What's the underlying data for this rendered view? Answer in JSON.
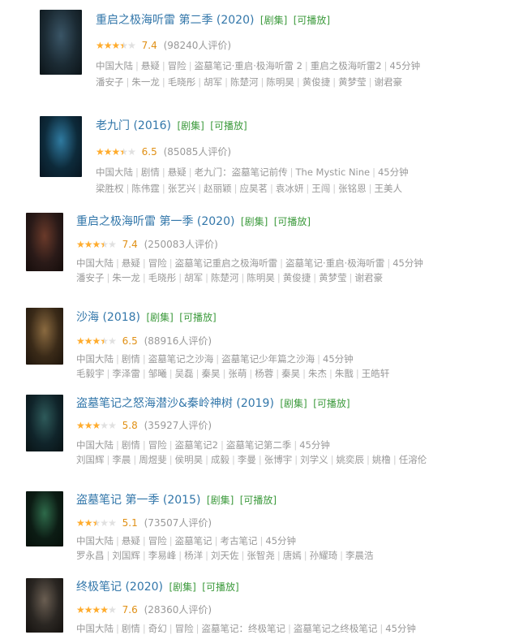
{
  "items": [
    {
      "title": "重启之极海听雷 第二季 (2020)",
      "badges": [
        "[剧集]",
        "[可播放]"
      ],
      "rating": 7.4,
      "stars": 3.5,
      "score": "7.4",
      "votes": "(98240人评价)",
      "meta": [
        "中国大陆",
        "悬疑",
        "冒险",
        "盗墓笔记·重启·极海听雷 2",
        "重启之极海听雷2",
        "45分钟"
      ],
      "cast": [
        "潘安子",
        "朱一龙",
        "毛晓彤",
        "胡军",
        "陈楚河",
        "陈明昊",
        "黄俊捷",
        "黄梦莹",
        "谢君豪"
      ],
      "poster_colors": [
        "#1b2a33",
        "#3a5566",
        "#0c1418"
      ]
    },
    {
      "title": "老九门 (2016)",
      "badges": [
        "[剧集]",
        "[可播放]"
      ],
      "rating": 6.5,
      "stars": 3.5,
      "score": "6.5",
      "votes": "(85085人评价)",
      "meta": [
        "中国大陆",
        "剧情",
        "悬疑",
        "老九门：盗墓笔记前传",
        "The Mystic Nine",
        "45分钟"
      ],
      "cast": [
        "梁胜权",
        "陈伟霆",
        "张艺兴",
        "赵丽颖",
        "应昊茗",
        "袁冰妍",
        "王闯",
        "张铭恩",
        "王美人"
      ],
      "poster_colors": [
        "#0d2a3a",
        "#2f7aa0",
        "#081520"
      ]
    },
    {
      "title": "重启之极海听雷 第一季 (2020)",
      "badges": [
        "[剧集]",
        "[可播放]"
      ],
      "rating": 7.4,
      "stars": 3.5,
      "score": "7.4",
      "votes": "(250083人评价)",
      "meta": [
        "中国大陆",
        "悬疑",
        "冒险",
        "盗墓笔记重启之极海听雷",
        "盗墓笔记·重启·极海听雷",
        "45分钟"
      ],
      "cast": [
        "潘安子",
        "朱一龙",
        "毛晓彤",
        "胡军",
        "陈楚河",
        "陈明昊",
        "黄俊捷",
        "黄梦莹",
        "谢君豪"
      ],
      "poster_colors": [
        "#2a1a18",
        "#6a3a2a",
        "#140c0a"
      ]
    },
    {
      "title": "沙海 (2018)",
      "badges": [
        "[剧集]",
        "[可播放]"
      ],
      "rating": 6.5,
      "stars": 3.5,
      "score": "6.5",
      "votes": "(88916人评价)",
      "meta": [
        "中国大陆",
        "剧情",
        "盗墓笔记之沙海",
        "盗墓笔记少年篇之沙海",
        "45分钟"
      ],
      "cast": [
        "毛毅宇",
        "李泽雷",
        "邹曦",
        "吴磊",
        "秦昊",
        "张萌",
        "杨蓉",
        "秦昊",
        "朱杰",
        "朱戬",
        "王皓轩"
      ],
      "poster_colors": [
        "#3a2a18",
        "#8a6a40",
        "#1e150c"
      ]
    },
    {
      "title": "盗墓笔记之怒海潜沙&秦岭神树 (2019)",
      "badges": [
        "[剧集]",
        "[可播放]"
      ],
      "rating": 5.8,
      "stars": 3,
      "score": "5.8",
      "votes": "(35927人评价)",
      "meta": [
        "中国大陆",
        "剧情",
        "冒险",
        "盗墓笔记2",
        "盗墓笔记第二季",
        "45分钟"
      ],
      "cast": [
        "刘国辉",
        "李晨",
        "周煜斐",
        "侯明昊",
        "成毅",
        "李曼",
        "张博宇",
        "刘学义",
        "姚奕辰",
        "姚橹",
        "任溶伦"
      ],
      "poster_colors": [
        "#10242a",
        "#2e5a5a",
        "#081214"
      ]
    },
    {
      "title": "盗墓笔记 第一季 (2015)",
      "badges": [
        "[剧集]",
        "[可播放]"
      ],
      "rating": 5.1,
      "stars": 2.5,
      "score": "5.1",
      "votes": "(73507人评价)",
      "meta": [
        "中国大陆",
        "悬疑",
        "冒险",
        "盗墓笔记",
        "考古笔记",
        "45分钟"
      ],
      "cast": [
        "罗永昌",
        "刘国辉",
        "李易峰",
        "杨洋",
        "刘天佐",
        "张智尧",
        "唐嫣",
        "孙耀琦",
        "李晨浩"
      ],
      "poster_colors": [
        "#0c1c14",
        "#2e6a4a",
        "#06100a"
      ]
    },
    {
      "title": "终极笔记 (2020)",
      "badges": [
        "[剧集]",
        "[可播放]"
      ],
      "rating": 7.6,
      "stars": 4,
      "score": "7.6",
      "votes": "(28360人评价)",
      "meta": [
        "中国大陆",
        "剧情",
        "奇幻",
        "冒险",
        "盗墓笔记：终极笔记",
        "盗墓笔记之终极笔记",
        "45分钟"
      ],
      "cast": [],
      "poster_colors": [
        "#2a2622",
        "#6a5e52",
        "#14110e"
      ]
    }
  ]
}
